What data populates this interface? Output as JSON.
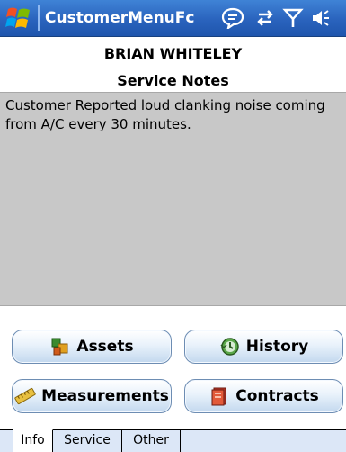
{
  "titlebar": {
    "title": "CustomerMenuFc",
    "icons": [
      "windows-start-icon",
      "messaging-icon",
      "connectivity-icon",
      "signal-icon",
      "volume-icon"
    ]
  },
  "header": {
    "customer_name": "BRIAN WHITELEY",
    "section_title": "Service Notes"
  },
  "notes": {
    "text": "Customer Reported loud clanking noise coming from A/C every 30 minutes."
  },
  "buttons": {
    "assets": "Assets",
    "history": "History",
    "measurements": "Measurements",
    "contracts": "Contracts"
  },
  "tabs": [
    {
      "label": "Info",
      "selected": true
    },
    {
      "label": "Service",
      "selected": false
    },
    {
      "label": "Other",
      "selected": false
    }
  ],
  "colors": {
    "titlebar": "#2a63bd",
    "notes_background": "#c8c8c8",
    "tabbar_background": "#dce7f7"
  }
}
